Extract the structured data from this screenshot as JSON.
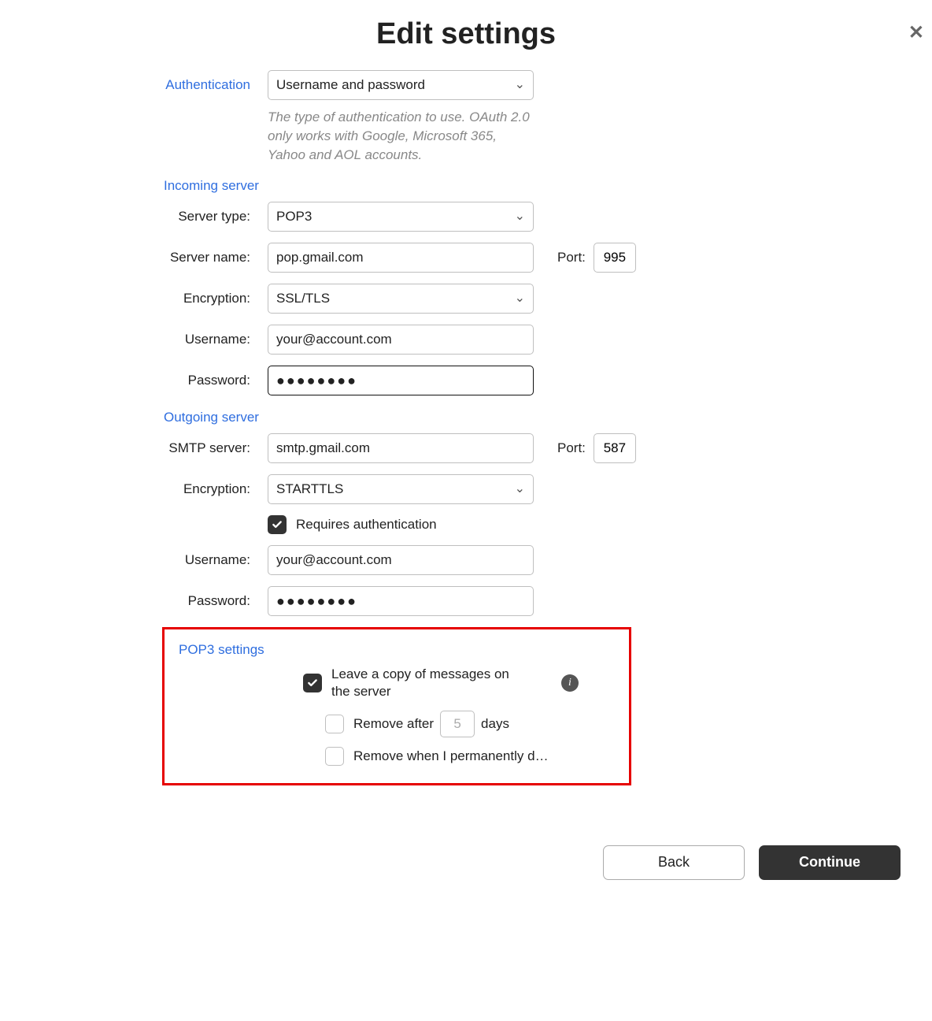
{
  "page_title": "Edit settings",
  "auth": {
    "label": "Authentication",
    "value": "Username and password",
    "desc": "The type of authentication to use. OAuth 2.0 only works with Google, Microsoft 365, Yahoo and AOL accounts."
  },
  "incoming": {
    "header": "Incoming server",
    "server_type_label": "Server type:",
    "server_type_value": "POP3",
    "server_name_label": "Server name:",
    "server_name_value": "pop.gmail.com",
    "port_label": "Port:",
    "port_value": "995",
    "encryption_label": "Encryption:",
    "encryption_value": "SSL/TLS",
    "username_label": "Username:",
    "username_value": "your@account.com",
    "password_label": "Password:",
    "password_value": "●●●●●●●●"
  },
  "outgoing": {
    "header": "Outgoing server",
    "smtp_label": "SMTP server:",
    "smtp_value": "smtp.gmail.com",
    "port_label": "Port:",
    "port_value": "587",
    "encryption_label": "Encryption:",
    "encryption_value": "STARTTLS",
    "requires_auth_label": "Requires authentication",
    "username_label": "Username:",
    "username_value": "your@account.com",
    "password_label": "Password:",
    "password_value": "●●●●●●●●"
  },
  "pop3": {
    "header": "POP3 settings",
    "leave_copy_label": "Leave a copy of messages on the server",
    "remove_after_prefix": "Remove after",
    "remove_after_days": "5",
    "remove_after_suffix": "days",
    "remove_when_label": "Remove when I permanently delete them from the Trash"
  },
  "footer": {
    "back": "Back",
    "continue": "Continue"
  }
}
